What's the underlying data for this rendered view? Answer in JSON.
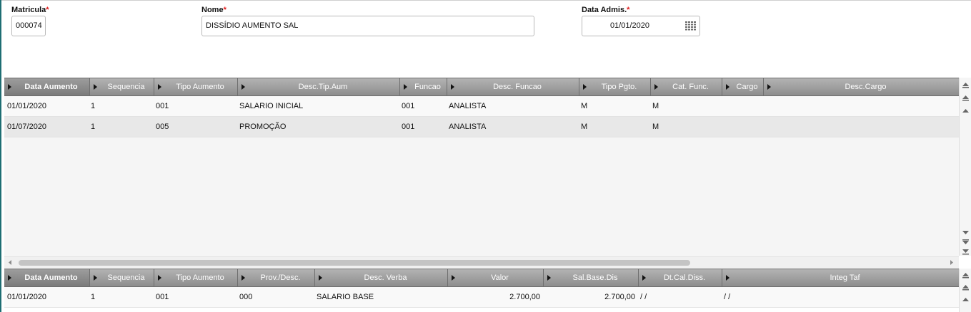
{
  "form": {
    "matricula": {
      "label": "Matricula",
      "required_mark": "*",
      "value": "000074"
    },
    "nome": {
      "label": "Nome",
      "required_mark": "*",
      "value": "DISSÍDIO AUMENTO SAL"
    },
    "data_admis": {
      "label": "Data Admis.",
      "required_mark": "*",
      "value": "01/01/2020"
    }
  },
  "grid1": {
    "columns": [
      "Data Aumento",
      "Sequencia",
      "Tipo Aumento",
      "Desc.Tip.Aum",
      "Funcao",
      "Desc. Funcao",
      "Tipo Pgto.",
      "Cat. Func.",
      "Cargo",
      "Desc.Cargo"
    ],
    "rows": [
      [
        "01/01/2020",
        "1",
        "001",
        "SALARIO INICIAL",
        "001",
        "ANALISTA",
        "M",
        "M",
        "",
        ""
      ],
      [
        "01/07/2020",
        "1",
        "005",
        "PROMOÇÃO",
        "001",
        "ANALISTA",
        "M",
        "M",
        "",
        ""
      ]
    ]
  },
  "grid2": {
    "columns": [
      "Data Aumento",
      "Sequencia",
      "Tipo Aumento",
      "Prov./Desc.",
      "Desc. Verba",
      "Valor",
      "Sal.Base.Dis",
      "Dt.Cal.Diss.",
      "Integ Taf"
    ],
    "rows": [
      [
        "01/01/2020",
        "1",
        "001",
        "000",
        "SALARIO BASE",
        "2.700,00",
        "2.700,00",
        " / /",
        " / /"
      ]
    ]
  },
  "colors": {
    "header": "#9a9a9a",
    "required": "#e01919",
    "row_alt": "#e8e8e8",
    "accent_line": "#1e6e73"
  },
  "icons": [
    "calendar-icon",
    "column-sort-arrow-icon",
    "scroll-up-icon",
    "scroll-down-icon",
    "scroll-left-icon",
    "scroll-right-icon"
  ]
}
